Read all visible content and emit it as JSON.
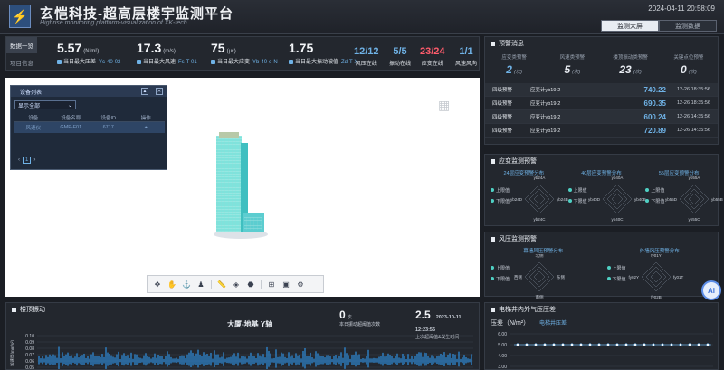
{
  "header": {
    "logo_glyph": "⚡",
    "title": "玄恺科技-超高层楼宇监测平台",
    "subtitle": "Highrise monitoring platform-visualization of XK-tech",
    "datetime": "2024-04-11 20:58:09",
    "tabs": [
      {
        "label": "监测大屏",
        "active": true
      },
      {
        "label": "监测数据",
        "active": false
      }
    ]
  },
  "statsbar": {
    "side_tabs": [
      "数据一览",
      "项目信息"
    ],
    "stats": [
      {
        "value": "5.57",
        "unit": "(N/m²)",
        "label": "当日最大压差",
        "code": "Yc-40-02"
      },
      {
        "value": "17.3",
        "unit": "(m/s)",
        "label": "当日最大风速",
        "code": "Fs-T-01"
      },
      {
        "value": "75",
        "unit": "(με)",
        "label": "当日最大应变",
        "code": "Yb-40-e-N"
      },
      {
        "value": "1.75",
        "unit": "",
        "label": "当日最大振动被值",
        "code": "Zd-T-X"
      }
    ],
    "counts": [
      {
        "value": "12/12",
        "label": "风压在线",
        "color": "#6fb2e6"
      },
      {
        "value": "5/5",
        "label": "振动在线",
        "color": "#6fb2e6"
      },
      {
        "value": "23/24",
        "label": "应变在线",
        "color": "#ff5c6c"
      },
      {
        "value": "1/1",
        "label": "风速风向",
        "color": "#6fb2e6"
      }
    ]
  },
  "devices": {
    "title": "设备列表",
    "filter_value": "显示全部",
    "columns": [
      "设备",
      "设备名称",
      "设备ID",
      "操作"
    ],
    "rows": [
      {
        "type": "风速仪",
        "name": "GMP-F01",
        "id": "6717"
      }
    ],
    "page": "1"
  },
  "warnings": {
    "title": "预警消息",
    "stats": [
      {
        "label": "应变类预警",
        "value": "2",
        "unit": "(次)",
        "blue": true
      },
      {
        "label": "风速类预警",
        "value": "5",
        "unit": "(次)",
        "blue": false
      },
      {
        "label": "楼顶振动类预警",
        "value": "23",
        "unit": "(次)",
        "blue": false
      },
      {
        "label": "关键点位预警",
        "value": "0",
        "unit": "(次)",
        "blue": false
      }
    ],
    "rows": [
      {
        "level": "四级预警",
        "point": "应变计yb19-2",
        "value": "740.22",
        "time": "12-26 18:35:56"
      },
      {
        "level": "四级预警",
        "point": "应变计yb19-2",
        "value": "690.35",
        "time": "12-26 18:35:56"
      },
      {
        "level": "四级预警",
        "point": "应变计yb19-2",
        "value": "600.24",
        "time": "12-26 14:35:56"
      },
      {
        "level": "四级预警",
        "point": "应变计yb19-2",
        "value": "720.89",
        "time": "12-26 14:35:56"
      }
    ]
  },
  "strain": {
    "title": "应变监测预警",
    "charts": [
      {
        "title": "24层应变预警分布",
        "labels": [
          "yb24A",
          "yb24B",
          "yb24C",
          "yb24D"
        ]
      },
      {
        "title": "40层应变预警分布",
        "labels": [
          "yb40A",
          "yb40B",
          "yb40C",
          "yb40D"
        ]
      },
      {
        "title": "55层应变预警分布",
        "labels": [
          "yb55A",
          "yb55B",
          "yb55C",
          "yb55D"
        ]
      }
    ],
    "legend": [
      "上限值",
      "下限值"
    ]
  },
  "wind": {
    "title": "风压监测预警",
    "charts": [
      {
        "title": "幕墙风压预警分布",
        "labels": [
          "北侧",
          "东侧",
          "南侧",
          "西侧"
        ]
      },
      {
        "title": "外墙风压预警分布",
        "labels": [
          "fy01Y",
          "fy01T",
          "fy02B",
          "fy02Y"
        ]
      }
    ],
    "legend": [
      "上限值",
      "下限值"
    ]
  },
  "vibration": {
    "title": "楼顶振动",
    "chart_title": "大厦-地基 Y轴",
    "count_value": "0",
    "count_unit": "次",
    "count_label": "本日振动超阈值次数",
    "max_value": "2.5",
    "max_time": "2023-10-11 12:23:56",
    "max_label": "上次超阈值&发生时间",
    "ylabel": "加速度(mm/s²)",
    "y_ticks": [
      "0.10",
      "0.09",
      "0.08",
      "0.07",
      "0.06",
      "0.05"
    ]
  },
  "elevator": {
    "title": "电梯井内外气压压差",
    "ylabel": "压差（N/m²）",
    "series_name": "电梯井压差",
    "y_ticks": [
      "6.00",
      "5.00",
      "4.00",
      "3.00"
    ]
  },
  "ai_badge": "Ai"
}
